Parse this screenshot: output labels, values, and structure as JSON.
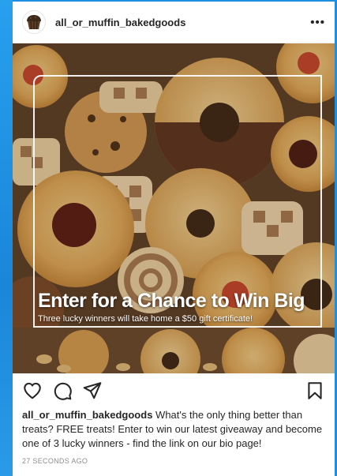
{
  "post": {
    "username": "all_or_muffin_bakedgoods",
    "more_label": "•••",
    "image": {
      "headline": "Enter for a Chance to Win Big",
      "subline": "Three lucky winners will take home a $50 gift certificate!"
    },
    "caption_username": "all_or_muffin_bakedgoods",
    "caption_text": "What's the only thing better than treats? FREE treats! Enter to win our latest giveaway and become one of 3 lucky winners - find the link on our bio page!",
    "timestamp": "27 SECONDS AGO"
  },
  "icons": {
    "avatar": "muffin-icon",
    "like": "heart-icon",
    "comment": "comment-bubble-icon",
    "share": "paper-plane-icon",
    "save": "bookmark-icon"
  },
  "colors": {
    "page_background": "#1e8fe0",
    "card_background": "#ffffff",
    "text_primary": "#262626",
    "text_secondary": "#8e8e8e"
  }
}
